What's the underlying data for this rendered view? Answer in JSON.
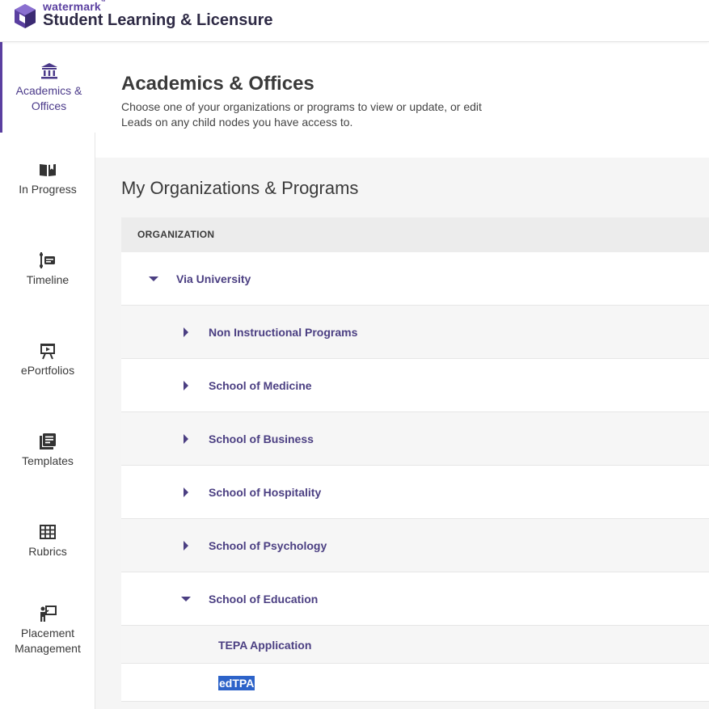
{
  "header": {
    "brand_small": "watermark",
    "brand_tm": "™",
    "brand_title": "Student Learning & Licensure"
  },
  "sidebar": {
    "items": [
      {
        "label_line1": "Academics &",
        "label_line2": "Offices",
        "icon": "bank-icon"
      },
      {
        "label": "In Progress",
        "icon": "open-book-icon"
      },
      {
        "label": "Timeline",
        "icon": "timeline-icon"
      },
      {
        "label": "ePortfolios",
        "icon": "easel-icon"
      },
      {
        "label": "Templates",
        "icon": "template-icon"
      },
      {
        "label": "Rubrics",
        "icon": "grid-icon"
      },
      {
        "label_line1": "Placement",
        "label_line2": "Management",
        "icon": "presenter-icon"
      }
    ]
  },
  "page": {
    "title": "Academics & Offices",
    "desc_line1": "Choose one of your organizations or programs to view or update, or edit",
    "desc_line2": "Leads on any child nodes you have access to."
  },
  "section": {
    "title": "My Organizations & Programs"
  },
  "table": {
    "header": "ORGANIZATION",
    "rows": [
      {
        "label": "Via University",
        "state": "expanded"
      },
      {
        "label": "Non Instructional Programs",
        "state": "collapsed"
      },
      {
        "label": "School of Medicine",
        "state": "collapsed"
      },
      {
        "label": "School of Business",
        "state": "collapsed"
      },
      {
        "label": "School of Hospitality",
        "state": "collapsed"
      },
      {
        "label": "School of Psychology",
        "state": "collapsed"
      },
      {
        "label": "School of Education",
        "state": "expanded"
      },
      {
        "label": "TEPA Application",
        "state": "leaf"
      },
      {
        "label": "edTPA",
        "state": "leaf"
      }
    ]
  },
  "colors": {
    "accent": "#5a3fa0",
    "link": "#4b3f82",
    "selection": "#2d63c9"
  }
}
